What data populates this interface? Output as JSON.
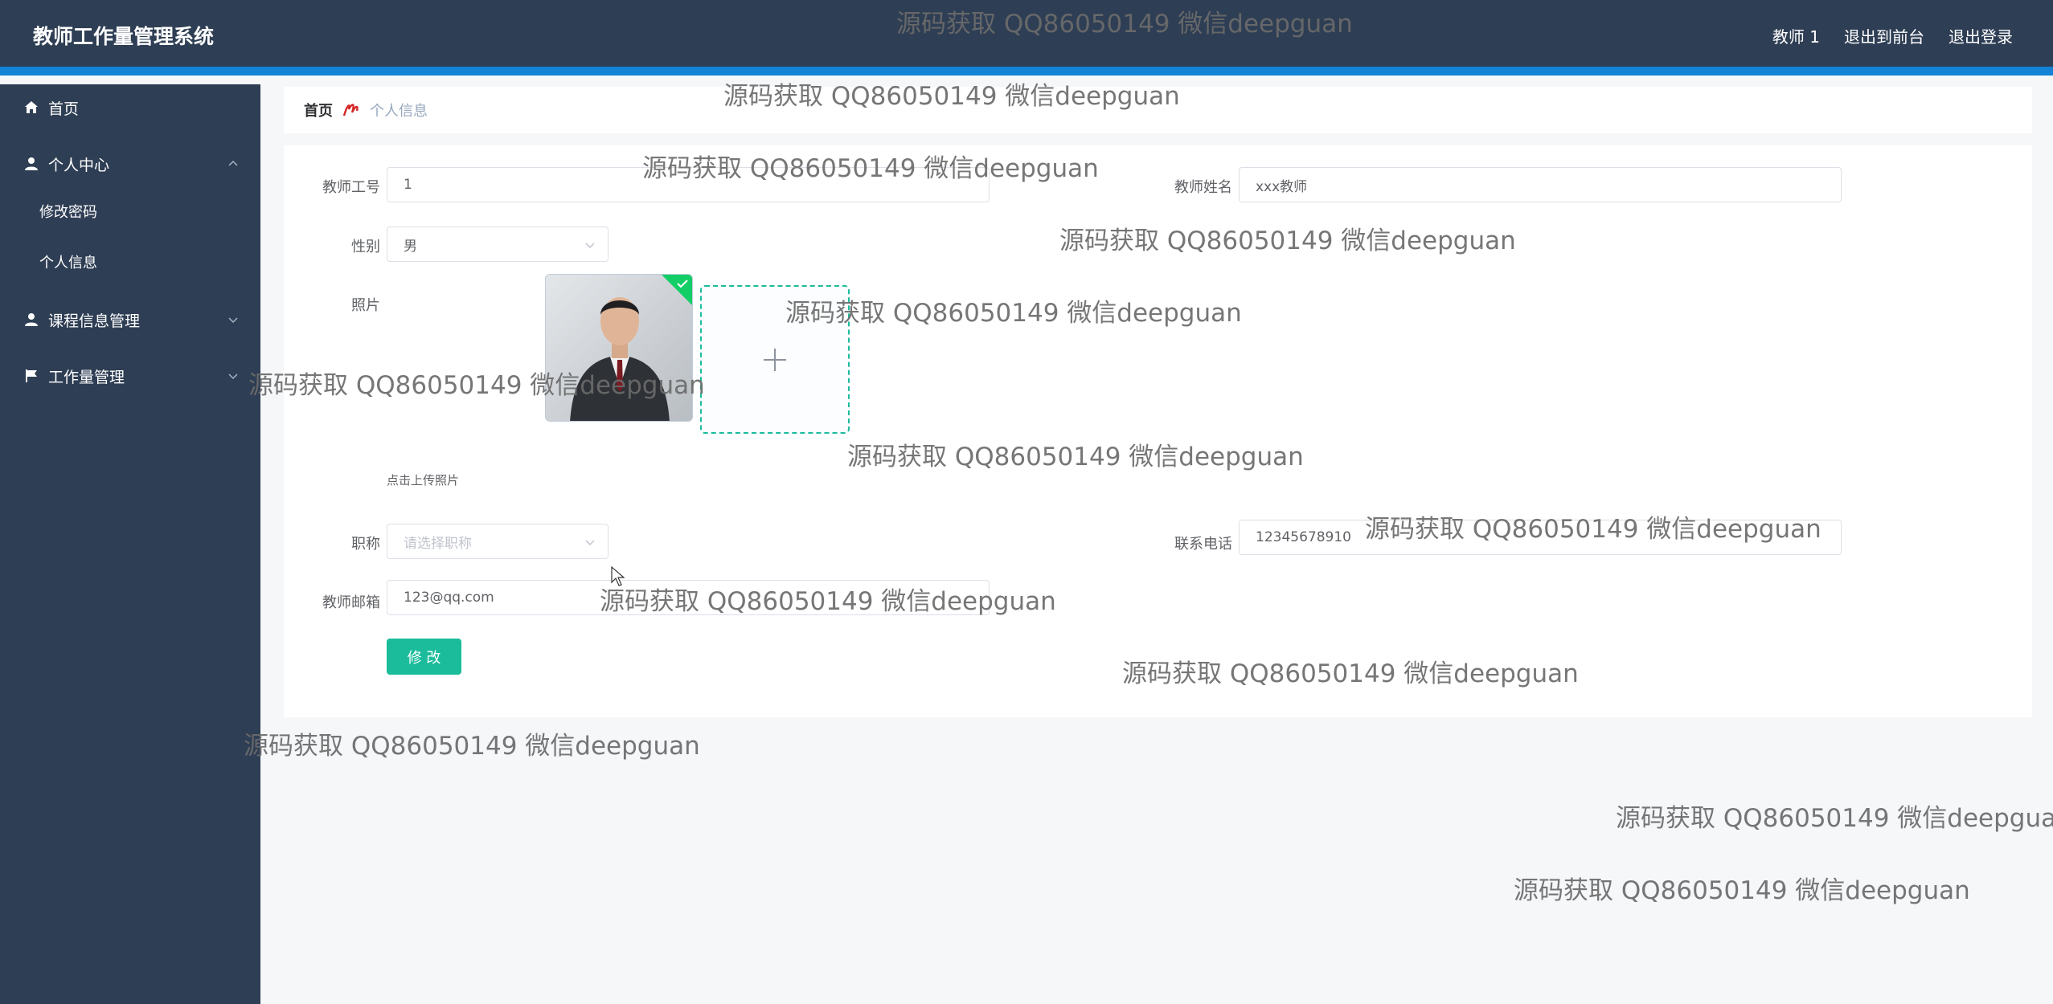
{
  "header": {
    "title": "教师工作量管理系统",
    "user": "教师 1",
    "to_front": "退出到前台",
    "logout": "退出登录"
  },
  "sidebar": {
    "items": [
      {
        "label": "首页",
        "icon": "home-icon"
      },
      {
        "label": "个人中心",
        "icon": "user-icon",
        "expanded": true,
        "children": [
          {
            "label": "修改密码"
          },
          {
            "label": "个人信息"
          }
        ]
      },
      {
        "label": "课程信息管理",
        "icon": "user-icon",
        "expanded": false
      },
      {
        "label": "工作量管理",
        "icon": "flag-icon",
        "expanded": false
      }
    ]
  },
  "breadcrumb": {
    "home": "首页",
    "current": "个人信息"
  },
  "form": {
    "teacher_id": {
      "label": "教师工号",
      "value": "1"
    },
    "teacher_name": {
      "label": "教师姓名",
      "value": "xxx教师"
    },
    "gender": {
      "label": "性别",
      "value": "男"
    },
    "photo": {
      "label": "照片",
      "tip": "点击上传照片"
    },
    "title": {
      "label": "职称",
      "placeholder": "请选择职称"
    },
    "phone": {
      "label": "联系电话",
      "value": "12345678910"
    },
    "email": {
      "label": "教师邮箱",
      "value": "123@qq.com"
    },
    "submit": "修 改"
  },
  "watermark": "源码获取 QQ86050149 微信deepguan",
  "colors": {
    "header_bg": "#2e3e54",
    "accent_bar": "#1482d6",
    "primary": "#1bbc9b",
    "page_bg": "#f5f7f9"
  }
}
